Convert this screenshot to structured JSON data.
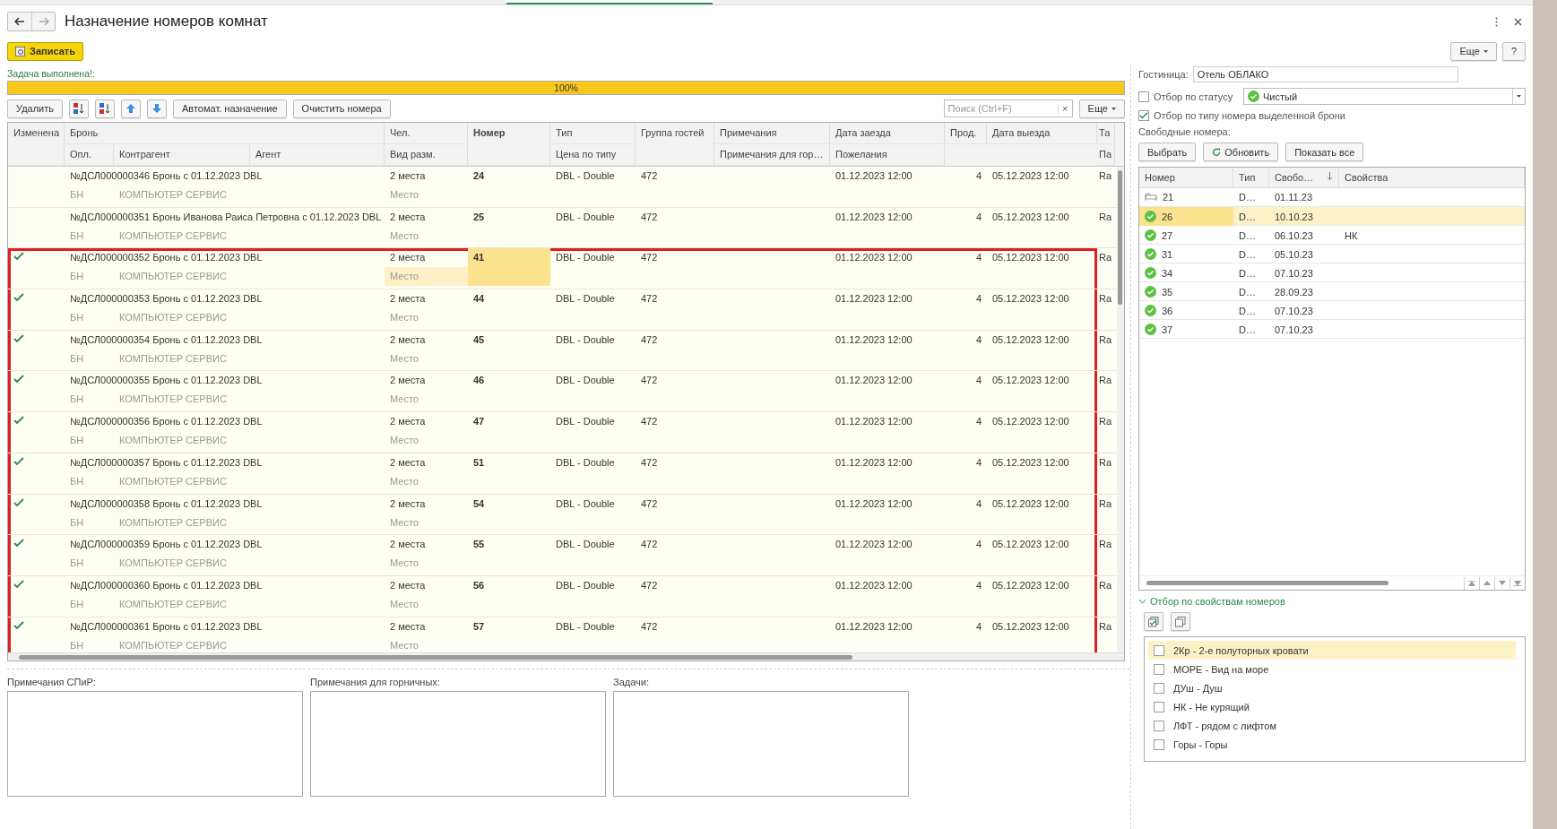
{
  "window": {
    "title": "Назначение номеров комнат"
  },
  "command_bar": {
    "save": "Записать",
    "more": "Еще",
    "help": "?"
  },
  "progress": {
    "label": "Задача выполнена!:",
    "level": 1,
    "reading": "100%"
  },
  "grid_toolbar": {
    "buttons": [
      {
        "kind": "text",
        "label": "Удалить"
      },
      {
        "kind": "sort-asc"
      },
      {
        "kind": "sort-desc"
      },
      {
        "kind": "up"
      },
      {
        "kind": "down"
      },
      {
        "kind": "text",
        "label": "Автомат. назначение"
      },
      {
        "kind": "text",
        "label": "Очистить номера"
      }
    ],
    "search": {
      "placeholder": "Поиск (Ctrl+F)",
      "clear": "×"
    },
    "more": "Еще"
  },
  "table": {
    "header": {
      "changed": "Изменена",
      "booking": "Бронь",
      "payment": "Опл.",
      "counterparty": "Контрагент",
      "agent": "Агент",
      "persons": "Чел.",
      "placement": "Вид разм.",
      "room": "Номер",
      "type": "Тип",
      "price": "Цена по типу",
      "group": "Группа гостей",
      "notes": "Примечания",
      "maid_notes": "Примечания для гор…",
      "arrival": "Дата заезда",
      "wishes": "Пожелания",
      "nights": "Прод.",
      "departure": "Дата выезда",
      "column_12": "Та",
      "column_12_sub": "Па"
    },
    "rows": [
      {
        "changed": false,
        "highlighted": false,
        "selected": false,
        "booking": "№ДСЛ000000346 Бронь с 01.12.2023 DBL",
        "persons": "2 места",
        "room": "24",
        "type": "DBL - Double",
        "group": "472",
        "arrival": "01.12.2023 12:00",
        "nights": "4",
        "departure": "05.12.2023 12:00",
        "column_12": "Ra",
        "payment": "БН",
        "counterparty": "КОМПЬЮТЕР СЕРВИС",
        "placement": "Место"
      },
      {
        "changed": false,
        "highlighted": false,
        "selected": false,
        "booking": "№ДСЛ000000351 Бронь Иванова Раиса Петровна с 01.12.2023 DBL",
        "persons": "2 места",
        "room": "25",
        "type": "DBL - Double",
        "group": "472",
        "arrival": "01.12.2023 12:00",
        "nights": "4",
        "departure": "05.12.2023 12:00",
        "column_12": "Ra",
        "payment": "БН",
        "counterparty": "КОМПЬЮТЕР СЕРВИС",
        "placement": "Место"
      },
      {
        "changed": true,
        "highlighted": true,
        "selected": true,
        "booking": "№ДСЛ000000352 Бронь с 01.12.2023 DBL",
        "persons": "2 места",
        "room": "41",
        "type": "DBL - Double",
        "group": "472",
        "arrival": "01.12.2023 12:00",
        "nights": "4",
        "departure": "05.12.2023 12:00",
        "column_12": "Ra",
        "payment": "БН",
        "counterparty": "КОМПЬЮТЕР СЕРВИС",
        "placement": "Место"
      },
      {
        "changed": true,
        "highlighted": true,
        "selected": false,
        "booking": "№ДСЛ000000353 Бронь с 01.12.2023 DBL",
        "persons": "2 места",
        "room": "44",
        "type": "DBL - Double",
        "group": "472",
        "arrival": "01.12.2023 12:00",
        "nights": "4",
        "departure": "05.12.2023 12:00",
        "column_12": "Ra",
        "payment": "БН",
        "counterparty": "КОМПЬЮТЕР СЕРВИС",
        "placement": "Место"
      },
      {
        "changed": true,
        "highlighted": true,
        "selected": false,
        "booking": "№ДСЛ000000354 Бронь с 01.12.2023 DBL",
        "persons": "2 места",
        "room": "45",
        "type": "DBL - Double",
        "group": "472",
        "arrival": "01.12.2023 12:00",
        "nights": "4",
        "departure": "05.12.2023 12:00",
        "column_12": "Ra",
        "payment": "БН",
        "counterparty": "КОМПЬЮТЕР СЕРВИС",
        "placement": "Место"
      },
      {
        "changed": true,
        "highlighted": true,
        "selected": false,
        "booking": "№ДСЛ000000355 Бронь с 01.12.2023 DBL",
        "persons": "2 места",
        "room": "46",
        "type": "DBL - Double",
        "group": "472",
        "arrival": "01.12.2023 12:00",
        "nights": "4",
        "departure": "05.12.2023 12:00",
        "column_12": "Ra",
        "payment": "БН",
        "counterparty": "КОМПЬЮТЕР СЕРВИС",
        "placement": "Место"
      },
      {
        "changed": true,
        "highlighted": true,
        "selected": false,
        "booking": "№ДСЛ000000356 Бронь с 01.12.2023 DBL",
        "persons": "2 места",
        "room": "47",
        "type": "DBL - Double",
        "group": "472",
        "arrival": "01.12.2023 12:00",
        "nights": "4",
        "departure": "05.12.2023 12:00",
        "column_12": "Ra",
        "payment": "БН",
        "counterparty": "КОМПЬЮТЕР СЕРВИС",
        "placement": "Место"
      },
      {
        "changed": true,
        "highlighted": true,
        "selected": false,
        "booking": "№ДСЛ000000357 Бронь с 01.12.2023 DBL",
        "persons": "2 места",
        "room": "51",
        "type": "DBL - Double",
        "group": "472",
        "arrival": "01.12.2023 12:00",
        "nights": "4",
        "departure": "05.12.2023 12:00",
        "column_12": "Ra",
        "payment": "БН",
        "counterparty": "КОМПЬЮТЕР СЕРВИС",
        "placement": "Место"
      },
      {
        "changed": true,
        "highlighted": true,
        "selected": false,
        "booking": "№ДСЛ000000358 Бронь с 01.12.2023 DBL",
        "persons": "2 места",
        "room": "54",
        "type": "DBL - Double",
        "group": "472",
        "arrival": "01.12.2023 12:00",
        "nights": "4",
        "departure": "05.12.2023 12:00",
        "column_12": "Ra",
        "payment": "БН",
        "counterparty": "КОМПЬЮТЕР СЕРВИС",
        "placement": "Место"
      },
      {
        "changed": true,
        "highlighted": true,
        "selected": false,
        "booking": "№ДСЛ000000359 Бронь с 01.12.2023 DBL",
        "persons": "2 места",
        "room": "55",
        "type": "DBL - Double",
        "group": "472",
        "arrival": "01.12.2023 12:00",
        "nights": "4",
        "departure": "05.12.2023 12:00",
        "column_12": "Ra",
        "payment": "БН",
        "counterparty": "КОМПЬЮТЕР СЕРВИС",
        "placement": "Место"
      },
      {
        "changed": true,
        "highlighted": true,
        "selected": false,
        "booking": "№ДСЛ000000360 Бронь с 01.12.2023 DBL",
        "persons": "2 места",
        "room": "56",
        "type": "DBL - Double",
        "group": "472",
        "arrival": "01.12.2023 12:00",
        "nights": "4",
        "departure": "05.12.2023 12:00",
        "column_12": "Ra",
        "payment": "БН",
        "counterparty": "КОМПЬЮТЕР СЕРВИС",
        "placement": "Место"
      },
      {
        "changed": true,
        "highlighted": true,
        "selected": false,
        "booking": "№ДСЛ000000361 Бронь с 01.12.2023 DBL",
        "persons": "2 места",
        "room": "57",
        "type": "DBL - Double",
        "group": "472",
        "arrival": "01.12.2023 12:00",
        "nights": "4",
        "departure": "05.12.2023 12:00",
        "column_12": "Ra",
        "payment": "БН",
        "counterparty": "КОМПЬЮТЕР СЕРВИС",
        "placement": "Место"
      }
    ]
  },
  "notes": [
    {
      "label": "Примечания СПиР:"
    },
    {
      "label": "Примечания для горничных:"
    },
    {
      "label": "Задачи:"
    }
  ],
  "side": {
    "hotel": {
      "label": "Гостиница:",
      "value": "Отель ОБЛАКО"
    },
    "status_filter": {
      "label": "Отбор по статусу",
      "checked": false,
      "value": "Чистый"
    },
    "type_filter": {
      "label": "Отбор по типу номера выделенной брони",
      "checked": true
    },
    "free_label": "Свободные номера:",
    "buttons": [
      {
        "kind": "plain",
        "label": "Выбрать"
      },
      {
        "kind": "refresh",
        "label": "Обновить"
      },
      {
        "kind": "plain",
        "label": "Показать все"
      }
    ],
    "rooms": {
      "columns": [
        "Номер",
        "Тип",
        "Свобо…",
        "Свойства"
      ],
      "rows": [
        {
          "kind": "bed",
          "number": "21",
          "type": "D…",
          "free": "01.11.23",
          "props": "",
          "selected": false
        },
        {
          "kind": "clean",
          "number": "26",
          "type": "D…",
          "free": "10.10.23",
          "selected": true
        },
        {
          "kind": "clean",
          "number": "27",
          "type": "D…",
          "free": "06.10.23",
          "props": "НК",
          "selected": false
        },
        {
          "kind": "clean",
          "number": "31",
          "type": "D…",
          "free": "05.10.23",
          "selected": false
        },
        {
          "kind": "clean",
          "number": "34",
          "type": "D…",
          "free": "07.10.23",
          "selected": false
        },
        {
          "kind": "clean",
          "number": "35",
          "type": "D…",
          "free": "28.09.23",
          "selected": false
        },
        {
          "kind": "clean",
          "number": "36",
          "type": "D…",
          "free": "07.10.23",
          "selected": false
        },
        {
          "kind": "clean",
          "number": "37",
          "type": "D…",
          "free": "07.10.23",
          "selected": false
        }
      ]
    },
    "properties": {
      "title": "Отбор по свойствам номеров",
      "expanded": true,
      "items": [
        {
          "label": "2Кр - 2-е полуторных кровати",
          "checked": false,
          "selected": true
        },
        {
          "label": "МОРЕ - Вид на море",
          "checked": false,
          "selected": false
        },
        {
          "label": "ДУш - Душ",
          "checked": false,
          "selected": false
        },
        {
          "label": "НК - Не курящий",
          "checked": false,
          "selected": false
        },
        {
          "label": "ЛФТ - рядом с лифтом",
          "checked": false,
          "selected": false
        },
        {
          "label": "Горы - Горы",
          "checked": false,
          "selected": false
        }
      ]
    }
  }
}
